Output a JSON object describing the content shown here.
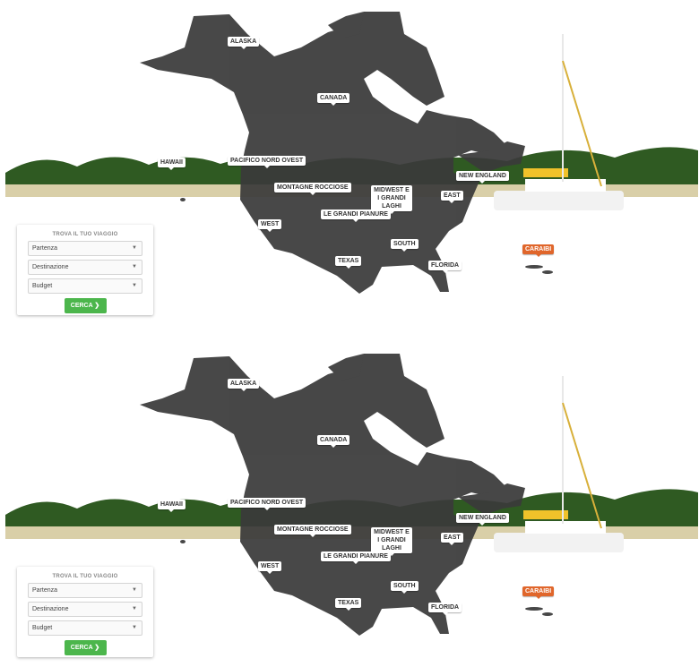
{
  "panels": [
    {
      "labels": {
        "alaska": "ALASKA",
        "canada": "CANADA",
        "hawaii": "HAWAII",
        "pacific_nw": "PACIFICO NORD OVEST",
        "new_england": "NEW ENGLAND",
        "rockies": "MONTAGNE ROCCIOSE",
        "midwest": "MIDWEST E I GRANDI LAGHI",
        "east": "EAST",
        "west": "WEST",
        "great_plains": "LE GRANDI PIANURE",
        "south": "SOUTH",
        "texas": "TEXAS",
        "florida": "FLORIDA",
        "caribbean": "CARAIBI"
      },
      "search": {
        "title": "TROVA IL TUO VIAGGIO",
        "departure": "Partenza",
        "destination": "Destinazione",
        "budget": "Budget",
        "button": "CERCA"
      }
    },
    {
      "labels": {
        "alaska": "ALASKA",
        "canada": "CANADA",
        "hawaii": "HAWAII",
        "pacific_nw": "PACIFICO NORD OVEST",
        "new_england": "NEW ENGLAND",
        "rockies": "MONTAGNE ROCCIOSE",
        "midwest": "MIDWEST E I GRANDI LAGHI",
        "east": "EAST",
        "west": "WEST",
        "great_plains": "LE GRANDI PIANURE",
        "south": "SOUTH",
        "texas": "TEXAS",
        "florida": "FLORIDA",
        "caribbean": "CARAIBI"
      },
      "search": {
        "title": "TROVA IL TUO VIAGGIO",
        "departure": "Partenza",
        "destination": "Destinazione",
        "budget": "Budget",
        "button": "CERCA"
      }
    }
  ],
  "icons": {
    "dropdown": "chevron-down-icon",
    "search_arrow": "chevron-right-icon"
  },
  "colors": {
    "sky": "#4a8fd6",
    "sea": "#3fd3c6",
    "map": "#3b3b3b",
    "search_button": "#4cb64c",
    "caribbean_badge": "#e0662b"
  }
}
